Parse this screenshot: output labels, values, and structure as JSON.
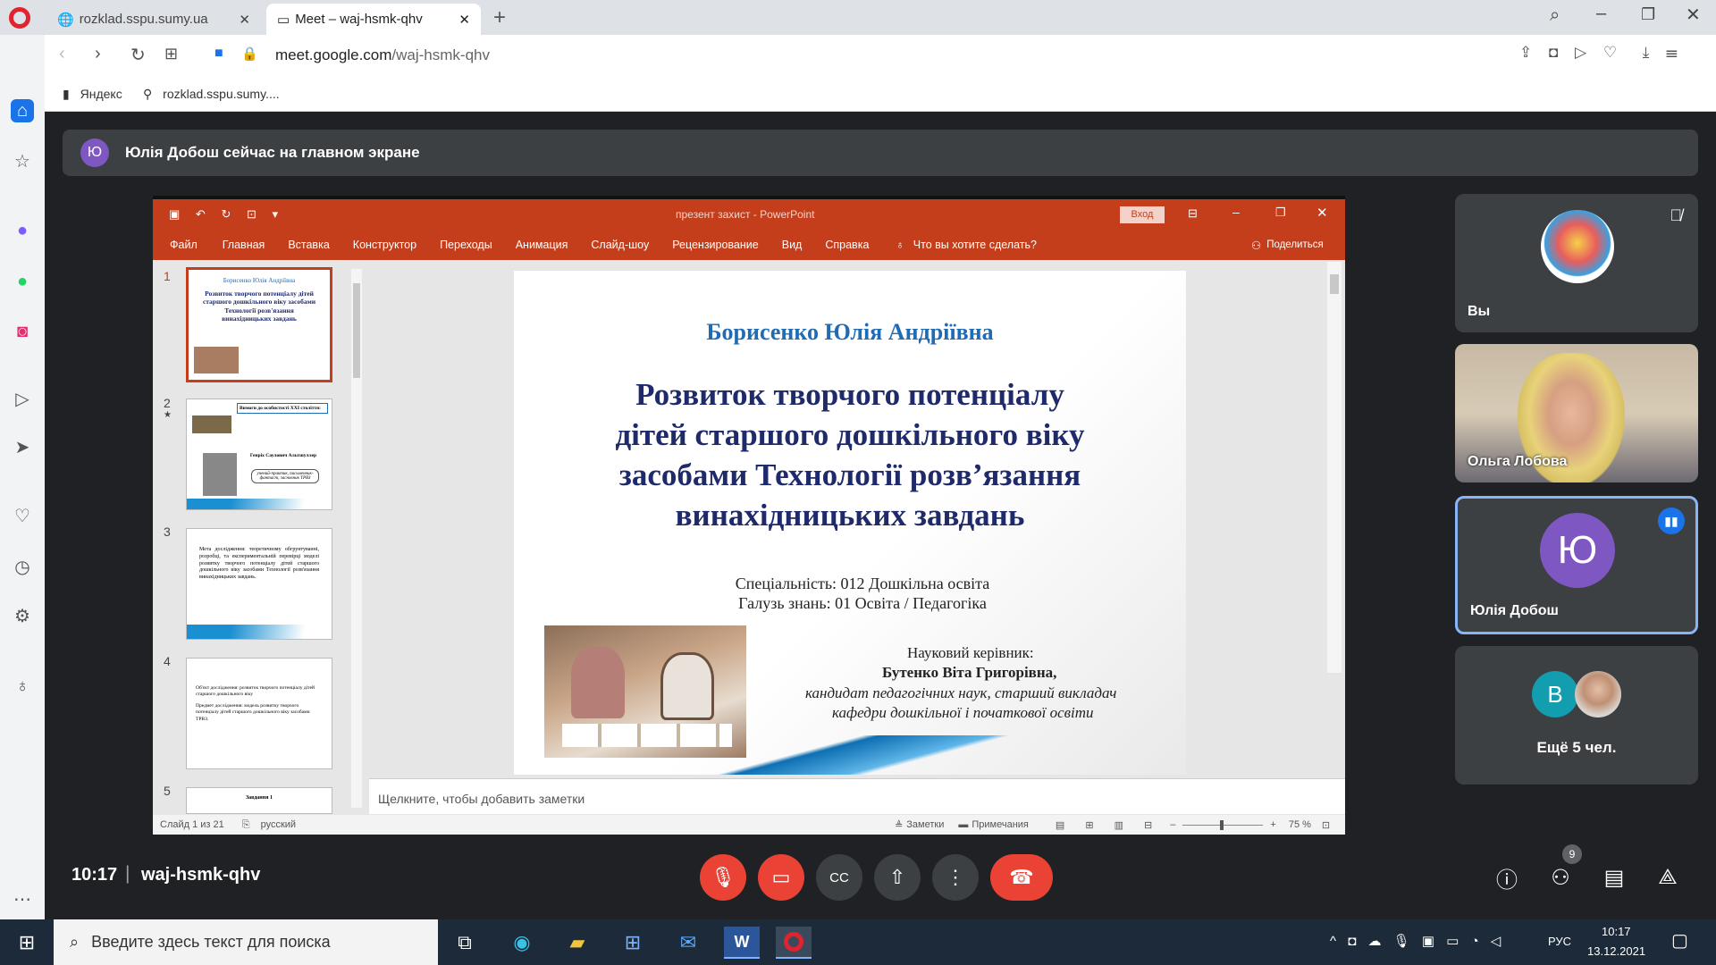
{
  "browser": {
    "tabs": [
      {
        "label": "rozklad.sspu.sumy.ua"
      },
      {
        "label": "Meet – waj-hsmk-qhv"
      }
    ],
    "url_domain": "meet.google.com",
    "url_path": "/waj-hsmk-qhv",
    "bookmarks": [
      "Яндекс",
      "rozklad.sspu.sumy...."
    ]
  },
  "meet": {
    "banner_avatar": "Ю",
    "banner_text": "Юлія Добош сейчас на главном экране",
    "time": "10:17",
    "separator": "|",
    "meeting_code": "waj-hsmk-qhv",
    "participants_count": "9",
    "tiles": {
      "you_label": "Вы",
      "olga_label": "Ольга Лобова",
      "yulia_avatar": "Ю",
      "yulia_label": "Юлія Добош",
      "more_avatar": "В",
      "more_label": "Ещё 5 чел."
    },
    "accent_blue": "#8ab4f8",
    "red": "#ea4335"
  },
  "powerpoint": {
    "doc_title": "презент захист  -  PowerPoint",
    "signin": "Вход",
    "menu": [
      "Файл",
      "Главная",
      "Вставка",
      "Конструктор",
      "Переходы",
      "Анимация",
      "Слайд-шоу",
      "Рецензирование",
      "Вид",
      "Справка"
    ],
    "tell_me": "Что вы хотите сделать?",
    "share": "Поделиться",
    "notes_placeholder": "Щелкните, чтобы добавить заметки",
    "status_slide": "Слайд 1 из 21",
    "status_lang": "русский",
    "status_notes": "Заметки",
    "status_comments": "Примечания",
    "zoom": "75 %",
    "thumb_numbers": [
      "1",
      "2",
      "3",
      "4",
      "5"
    ],
    "thumb1": {
      "author": "Борисенко Юлія Андріївна",
      "title": "Розвиток творчого потенціалу дітей старшого дошкільного віку засобами Технології розв'язання винахідницьких завдань"
    },
    "thumb2": {
      "heading": "Вимоги до особистості XXI століття:",
      "person": "Генріх Саулович Альтшуллер",
      "role": "учений-практик, письменник-фантаст, засновник ТРВЗ"
    },
    "thumb3": {
      "text": "Мета дослідження: теоретичному обгрунтуванні, розробці, та експериментальній перевірці моделі розвитку творчого потенціалу дітей старшого дошкільного віку засобами Технології розв'язання винахідницьких завдань."
    },
    "thumb4": {
      "text1": "Об'єкт дослідження: розвиток творчого потенціалу дітей старшого дошкільного віку",
      "text2": "Предмет дослідження: модель розвитку творчого потенціалу дітей старшого дошкільного віку засобами ТРВЗ."
    },
    "thumb5": {
      "text": "Завдання 1"
    },
    "brand_color": "#c43e1c"
  },
  "slide": {
    "author": "Борисенко Юлія Андріївна",
    "title_lines": [
      "Розвиток творчого потенціалу",
      "дітей старшого дошкільного віку",
      "засобами Технології розв’язання",
      "винахідницьких завдань"
    ],
    "specialty": "Спеціальність: 012 Дошкільна освіта",
    "field": "Галузь знань: 01 Освіта / Педагогіка",
    "supervisor_label": "Науковий керівник:",
    "supervisor_name": "Бутенко Віта Григорівна,",
    "supervisor_title_1": "кандидат педагогічних наук, старший викладач",
    "supervisor_title_2": "кафедри дошкільної і початкової освіти"
  },
  "taskbar": {
    "search_placeholder": "Введите здесь текст для поиска",
    "lang": "РУС",
    "time": "10:17",
    "date": "13.12.2021"
  }
}
